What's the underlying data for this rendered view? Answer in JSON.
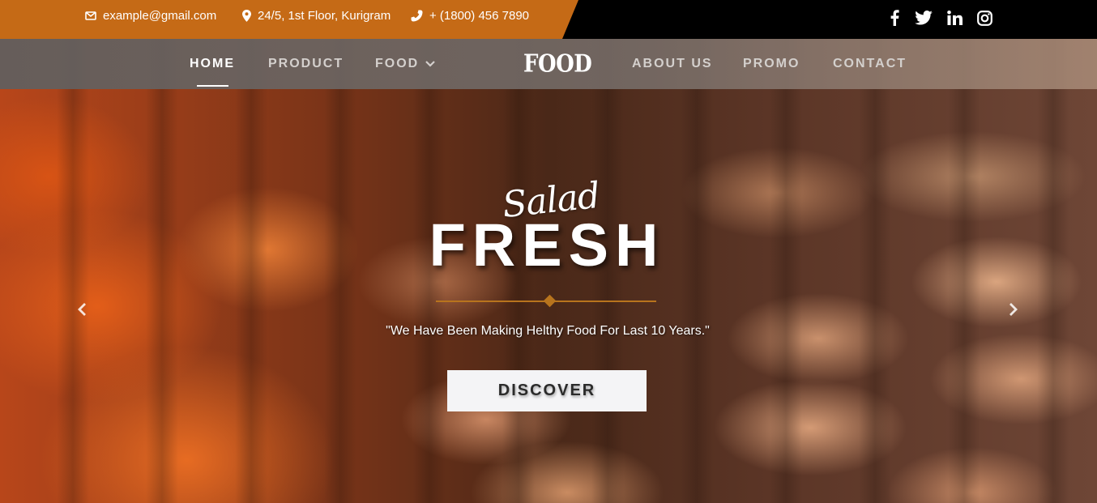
{
  "contact": {
    "email": "example@gmail.com",
    "address": "24/5, 1st Floor, Kurigram",
    "phone": "+ (1800) 456 7890"
  },
  "social": [
    {
      "icon": "facebook-icon"
    },
    {
      "icon": "twitter-icon"
    },
    {
      "icon": "linkedin-icon"
    },
    {
      "icon": "instagram-icon"
    }
  ],
  "nav": {
    "left": [
      {
        "label": "HOME",
        "active": true
      },
      {
        "label": "PRODUCT"
      },
      {
        "label": "FOOD",
        "dropdown": true
      }
    ],
    "brand": "FOOD",
    "right": [
      {
        "label": "ABOUT US"
      },
      {
        "label": "PROMO"
      },
      {
        "label": "CONTACT"
      }
    ]
  },
  "hero": {
    "script_title": "Salad",
    "title": "FRESH",
    "tagline": "\"We Have Been Making Helthy Food For Last 10 Years.\"",
    "cta_label": "DISCOVER"
  },
  "colors": {
    "accent": "#c56a16",
    "topbar": "#000000",
    "divider": "#b8741d",
    "cta_bg": "#f4f4f6"
  }
}
